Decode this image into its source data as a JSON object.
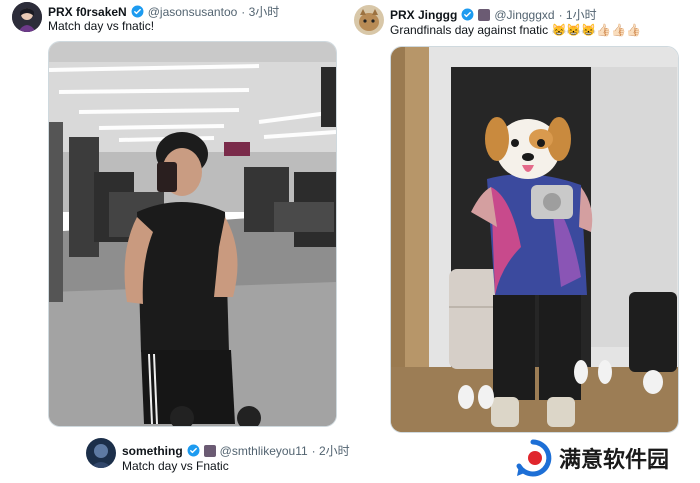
{
  "tweets": [
    {
      "name": "PRX f0rsakeN",
      "handle": "@jasonsusantoo",
      "time": "· 3小时",
      "text": "Match day vs fnatic!"
    },
    {
      "name": "PRX Jinggg",
      "handle": "@Jingggxd",
      "time": "· 1小时",
      "text": "Grandfinals day against fnatic",
      "emoji": "😸😸😸👍🏻👍🏻👍🏻"
    },
    {
      "name": "something",
      "handle": "@smthlikeyou11",
      "time": "· 2小时",
      "text": "Match day vs Fnatic"
    }
  ],
  "watermark": {
    "text": "满意软件园"
  },
  "colors": {
    "verified": "#1d9bf0",
    "watermark_blue": "#1d6fd6",
    "watermark_red": "#e0262d"
  }
}
